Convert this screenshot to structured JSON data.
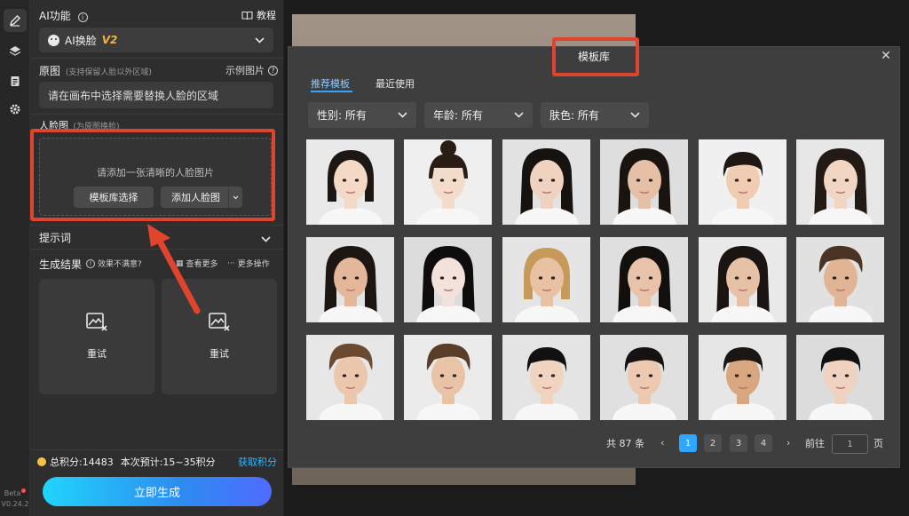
{
  "rail": {
    "icons": [
      "edit-icon",
      "layers-icon",
      "clipboard-icon",
      "gear-icon"
    ],
    "beta_label": "Beta",
    "version": "V0.24.2"
  },
  "panel": {
    "ai_function": {
      "title": "AI功能",
      "tutorial": "教程",
      "selected_tool": "AI换脸",
      "tool_version": "V2"
    },
    "source": {
      "title": "原图",
      "note": "(支持保留人脸以外区域)",
      "example": "示例图片",
      "instruction": "请在画布中选择需要替换人脸的区域"
    },
    "face": {
      "title": "人脸图",
      "note": "(为原图换脸)",
      "hint": "请添加一张清晰的人脸图片",
      "library_button": "模板库选择",
      "add_button": "添加人脸图"
    },
    "prompt": {
      "title": "提示词"
    },
    "results": {
      "title": "生成结果",
      "unsatisfied": "效果不满意?",
      "view_more": "查看更多",
      "more_actions": "更多操作",
      "retry_1": "重试",
      "retry_2": "重试"
    },
    "points": {
      "total": "总积分:14483",
      "estimate": "本次预计:15~35积分",
      "get_points": "获取积分"
    },
    "generate_button": "立即生成"
  },
  "modal": {
    "title": "模板库",
    "tabs": [
      "推荐模板",
      "最近使用"
    ],
    "active_tab": 0,
    "filters": [
      {
        "label": "性别: 所有"
      },
      {
        "label": "年龄: 所有"
      },
      {
        "label": "肤色: 所有"
      }
    ],
    "templates": [
      {
        "hair": "#1c1714",
        "skin": "#f3d9c6",
        "bg": "#e9e9e9",
        "style": "bob"
      },
      {
        "hair": "#2a1d16",
        "skin": "#f4dccb",
        "bg": "#efefef",
        "style": "bun"
      },
      {
        "hair": "#161210",
        "skin": "#efd3c0",
        "bg": "#e2e2e2",
        "style": "long"
      },
      {
        "hair": "#1a1411",
        "skin": "#e5c0a6",
        "bg": "#dedede",
        "style": "long"
      },
      {
        "hair": "#1f1713",
        "skin": "#f0cdb2",
        "bg": "#f0f0f0",
        "style": "short"
      },
      {
        "hair": "#241a15",
        "skin": "#f2d6c4",
        "bg": "#e7e7e7",
        "style": "long"
      },
      {
        "hair": "#1c1612",
        "skin": "#e4b79a",
        "bg": "#e3e3e3",
        "style": "long"
      },
      {
        "hair": "#0e0c0c",
        "skin": "#f3e2dc",
        "bg": "#dcdcdc",
        "style": "long"
      },
      {
        "hair": "#c79a5a",
        "skin": "#e9c2a3",
        "bg": "#e5e5e5",
        "style": "bob"
      },
      {
        "hair": "#120f0d",
        "skin": "#e8c2a9",
        "bg": "#dfdfdf",
        "style": "long"
      },
      {
        "hair": "#1a1412",
        "skin": "#e7c1a6",
        "bg": "#e9e9e9",
        "style": "long"
      },
      {
        "hair": "#4a3322",
        "skin": "#e1b496",
        "bg": "#e1e1e1",
        "style": "male"
      },
      {
        "hair": "#6b4a30",
        "skin": "#ebc7ad",
        "bg": "#e7e7e7",
        "style": "male"
      },
      {
        "hair": "#5a3d29",
        "skin": "#e9c3a6",
        "bg": "#ebebeb",
        "style": "male"
      },
      {
        "hair": "#121010",
        "skin": "#f1d4c0",
        "bg": "#e4e4e4",
        "style": "boy"
      },
      {
        "hair": "#151211",
        "skin": "#ecc9b0",
        "bg": "#e0e0e0",
        "style": "boy"
      },
      {
        "hair": "#1a1613",
        "skin": "#d9a77f",
        "bg": "#e6e6e6",
        "style": "boy"
      },
      {
        "hair": "#101010",
        "skin": "#efd2bf",
        "bg": "#dcdcdc",
        "style": "boy"
      }
    ],
    "pagination": {
      "total": "共 87 条",
      "pages": [
        "1",
        "2",
        "3",
        "4"
      ],
      "current": 1,
      "goto_label": "前往",
      "goto_value": "1",
      "page_suffix": "页"
    }
  },
  "colors": {
    "accent": "#2fa6ff",
    "highlight_red": "#e0442d",
    "coin": "#f5c445",
    "version_gold": "#f3b347"
  }
}
